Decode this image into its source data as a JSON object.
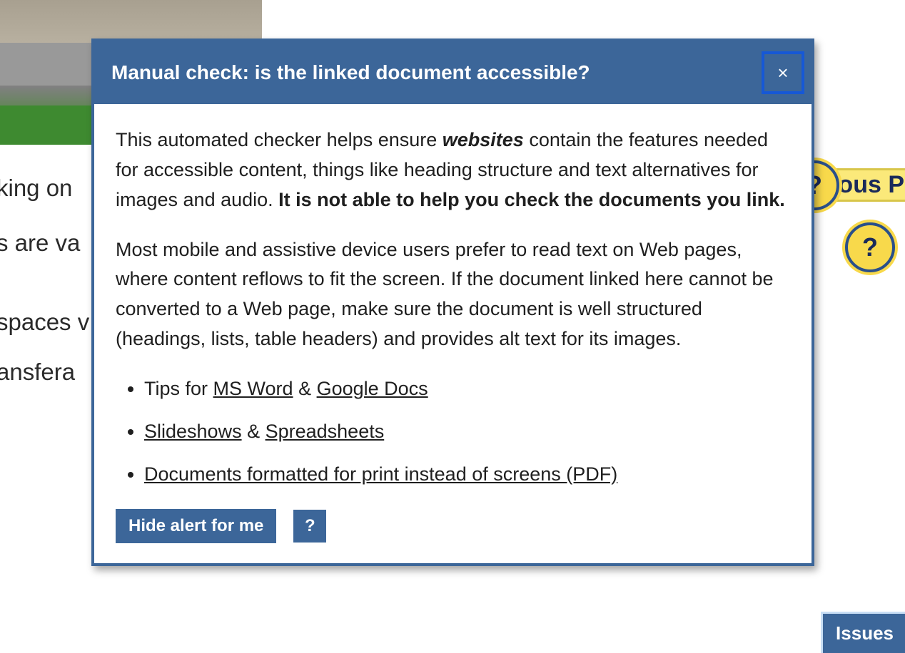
{
  "background": {
    "text_lines": [
      "king on",
      "s are va",
      "spaces v",
      "ansfera"
    ],
    "link_text": "ous P"
  },
  "badges": {
    "glyph": "?"
  },
  "dialog": {
    "title": "Manual check: is the linked document accessible?",
    "close_glyph": "×",
    "para1": {
      "pre": "This automated checker helps ensure ",
      "em": "websites",
      "mid": " contain the features needed for accessible content, things like heading structure and text alternatives for images and audio. ",
      "bold": "It is not able to help you check the documents you link."
    },
    "para2": "Most mobile and assistive device users prefer to read text on Web pages, where content reflows to fit the screen. If the document linked here cannot be converted to a Web page, make sure the document is well structured (headings, lists, table headers) and provides alt text for its images.",
    "list": [
      {
        "pre": "Tips for ",
        "link1": "MS Word",
        "mid": " & ",
        "link2": "Google Docs"
      },
      {
        "link1": "Slideshows",
        "mid": " & ",
        "link2": "Spreadsheets"
      },
      {
        "link1": "Documents formatted for print instead of screens (PDF)"
      }
    ],
    "hide_label": "Hide alert for me",
    "help_glyph": "?"
  },
  "issues_tab": "Issues"
}
